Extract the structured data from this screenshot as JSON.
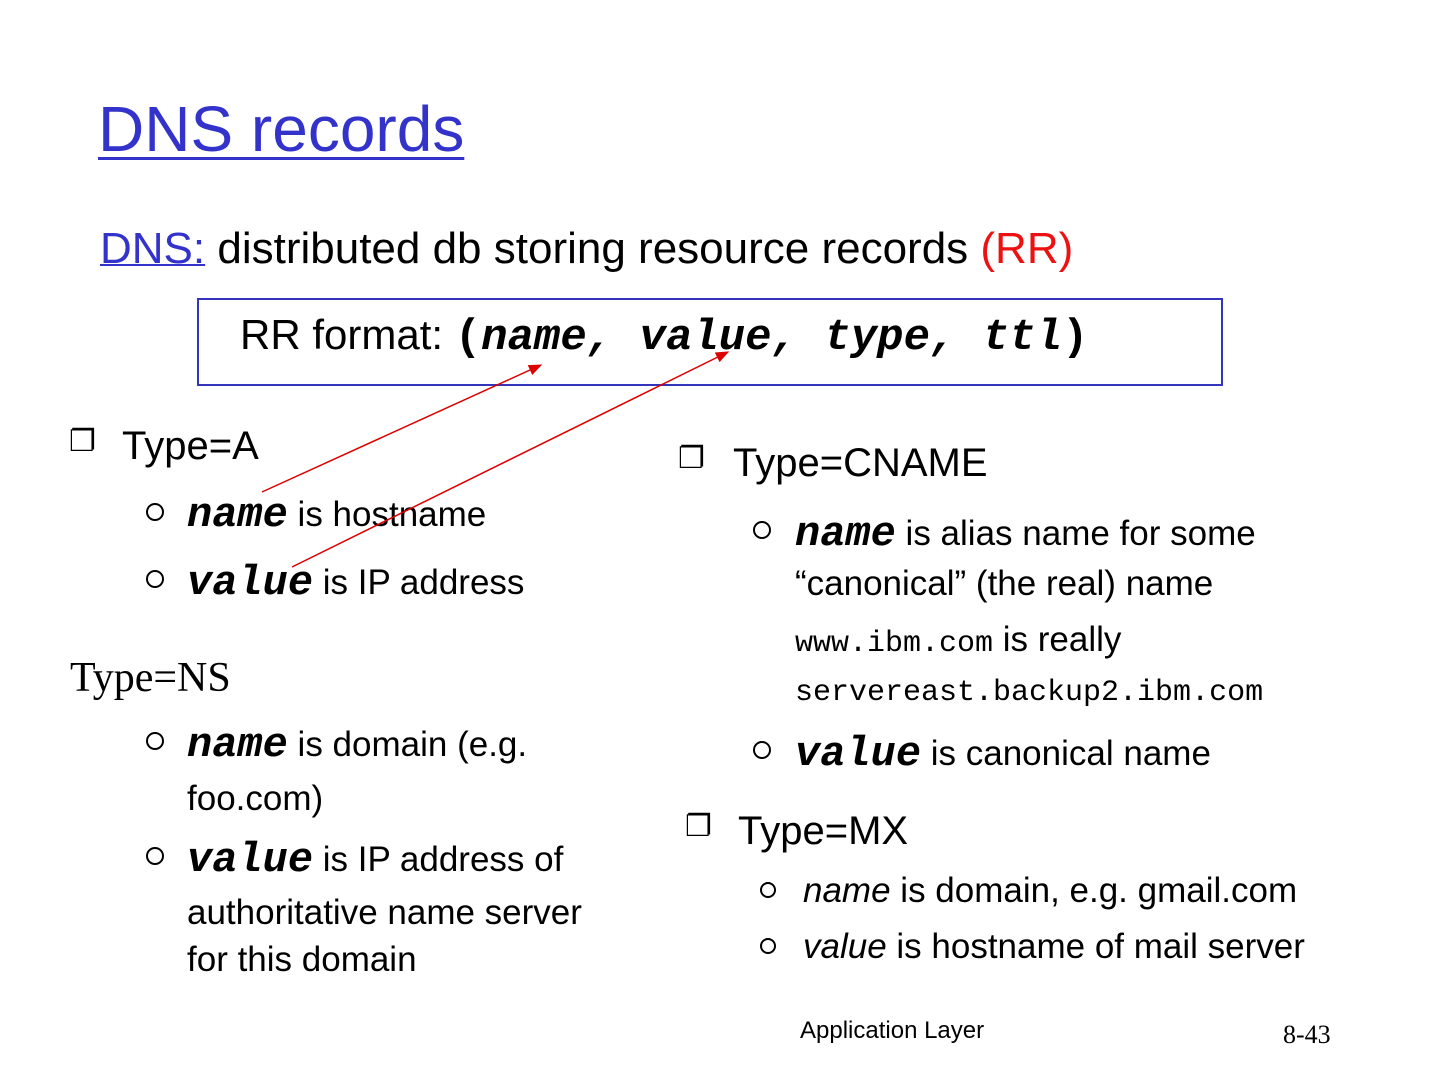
{
  "title": "DNS records",
  "subtitle": {
    "prefix": "DNS:",
    "text": " distributed db storing resource records ",
    "rr": "(RR)"
  },
  "format": {
    "label": "RR format: ",
    "open": "(",
    "fields": "name, value, type, ttl",
    "close": ")"
  },
  "type_a": {
    "heading": "Type=A",
    "name_kw": "name",
    "name_text": " is hostname",
    "value_kw": "value",
    "value_text": " is IP address"
  },
  "type_ns": {
    "heading": "Type=NS",
    "name_kw": "name",
    "name_text": " is domain (e.g.",
    "name_text2": "foo.com)",
    "value_kw": "value",
    "value_text": " is IP address of",
    "value_text2": "authoritative name server",
    "value_text3": "for this domain"
  },
  "type_cname": {
    "heading": "Type=CNAME",
    "name_kw": "name",
    "name_text": " is alias name for some",
    "name_text2": "“canonical” (the real) name",
    "example_host": "www.ibm.com",
    "example_mid": " is really",
    "example_target": "servereast.backup2.ibm.com",
    "value_kw": "value",
    "value_text": " is canonical name"
  },
  "type_mx": {
    "heading": "Type=MX",
    "name_kw": "name",
    "name_text": " is domain, e.g. gmail.com",
    "value_kw": "value",
    "value_text": " is hostname of mail server"
  },
  "footer": {
    "label": "Application Layer",
    "page": "8-43"
  },
  "colors": {
    "title": "#3333cc",
    "accent_red": "#ee1111",
    "box_border": "#3333bb",
    "arrow": "#dd0000"
  },
  "icons": {
    "bullet_l1": "square-bullet-icon",
    "bullet_l2": "ring-bullet-icon"
  }
}
